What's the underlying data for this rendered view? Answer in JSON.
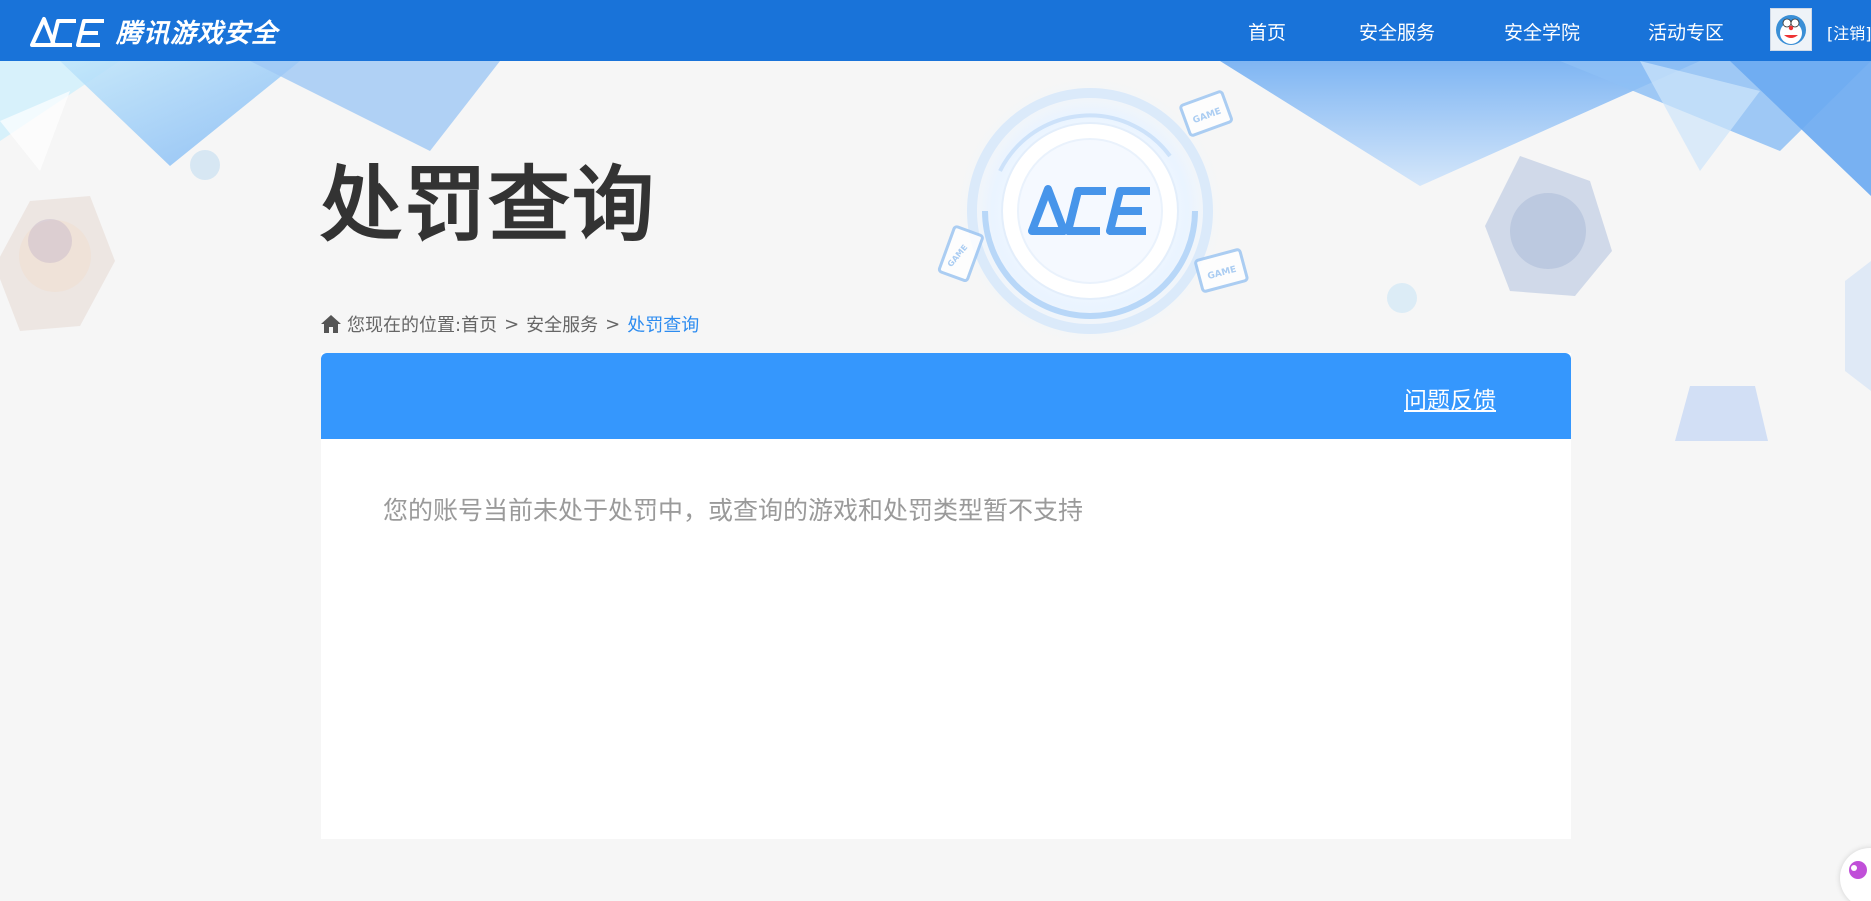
{
  "header": {
    "brand": "腾讯游戏安全",
    "nav": [
      {
        "label": "首页"
      },
      {
        "label": "安全服务"
      },
      {
        "label": "安全学院"
      },
      {
        "label": "活动专区"
      }
    ],
    "logout_label": "[注销]"
  },
  "hero": {
    "title": "处罚查询",
    "emblem_text": "ACE",
    "device_tags": [
      "GAME",
      "GAME",
      "GAME"
    ]
  },
  "breadcrumb": {
    "prefix": "您现在的位置:",
    "items": [
      "首页",
      "安全服务"
    ],
    "separator": ">",
    "current": "处罚查询"
  },
  "panel": {
    "feedback_label": "问题反馈",
    "message": "您的账号当前未处于处罚中，或查询的游戏和处罚类型暂不支持"
  },
  "colors": {
    "nav_bg": "#1973d9",
    "panel_header_bg": "#3597fd",
    "page_bg": "#f6f6f6",
    "breadcrumb_current": "#2d8cf0"
  }
}
